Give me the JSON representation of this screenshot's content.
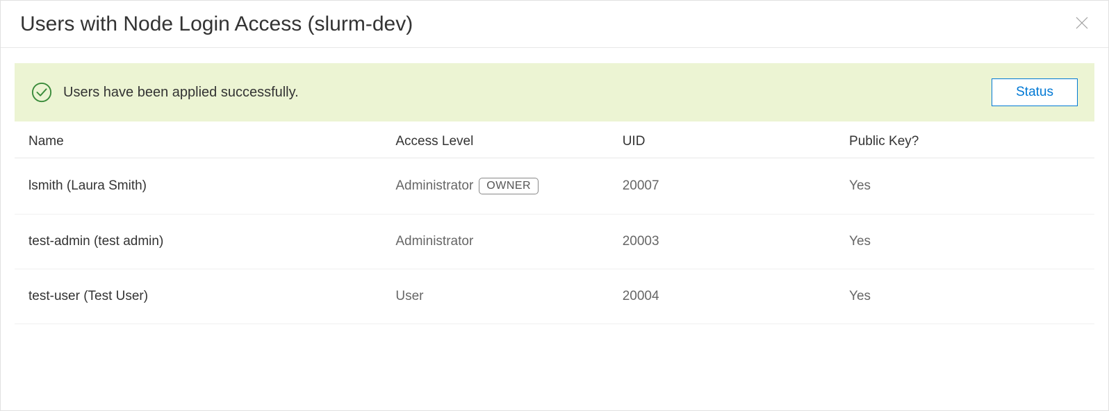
{
  "dialog": {
    "title": "Users with Node Login Access (slurm-dev)"
  },
  "alert": {
    "message": "Users have been applied successfully.",
    "status_button": "Status"
  },
  "table": {
    "headers": {
      "name": "Name",
      "access_level": "Access Level",
      "uid": "UID",
      "public_key": "Public Key?"
    },
    "rows": [
      {
        "name": "lsmith (Laura Smith)",
        "access_level": "Administrator",
        "owner_badge": "OWNER",
        "uid": "20007",
        "public_key": "Yes"
      },
      {
        "name": "test-admin (test admin)",
        "access_level": "Administrator",
        "owner_badge": "",
        "uid": "20003",
        "public_key": "Yes"
      },
      {
        "name": "test-user (Test User)",
        "access_level": "User",
        "owner_badge": "",
        "uid": "20004",
        "public_key": "Yes"
      }
    ]
  }
}
